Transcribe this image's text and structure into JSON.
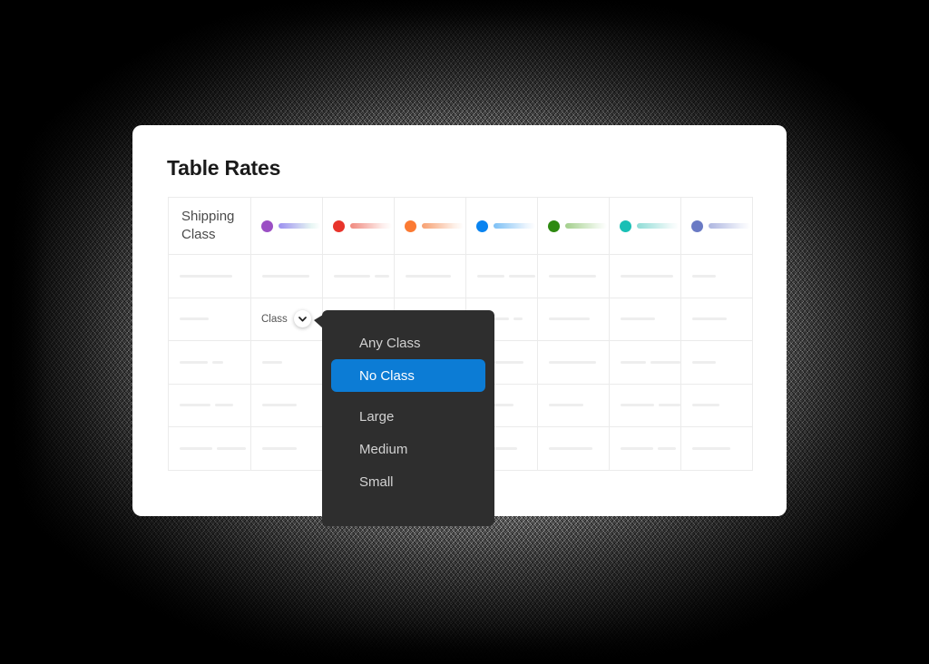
{
  "card": {
    "title": "Table Rates"
  },
  "table": {
    "first_column_header": "Shipping Class",
    "column_chips": [
      {
        "name": "chip-purple",
        "dot": "#9b4fc4",
        "bar_from": "#9b8ff0",
        "bar_to": "#e6f5f3"
      },
      {
        "name": "chip-red",
        "dot": "#e8342b",
        "bar_from": "#f0897e",
        "bar_to": "#fdeeec"
      },
      {
        "name": "chip-orange",
        "dot": "#fb7a33",
        "bar_from": "#f7a071",
        "bar_to": "#fdf0e8"
      },
      {
        "name": "chip-blue",
        "dot": "#0a84f0",
        "bar_from": "#7cc0f5",
        "bar_to": "#eaf4fd"
      },
      {
        "name": "chip-green",
        "dot": "#2e8a10",
        "bar_from": "#a3cf8c",
        "bar_to": "#eef7ea"
      },
      {
        "name": "chip-teal",
        "dot": "#19bfb5",
        "bar_from": "#8fdcd6",
        "bar_to": "#ecf8f7"
      },
      {
        "name": "chip-slate",
        "dot": "#6a7ac4",
        "bar_from": "#aeb6e0",
        "bar_to": "#f0f2fa"
      }
    ],
    "rows": [
      {
        "cells": [
          {
            "lines": [
              58
            ]
          },
          {
            "lines": [
              52
            ]
          },
          {
            "lines": [
              40,
              16
            ]
          },
          {
            "lines": [
              50
            ]
          },
          {
            "lines": [
              30,
              29
            ]
          },
          {
            "lines": [
              52
            ]
          },
          {
            "lines": [
              58
            ]
          },
          {
            "lines": [
              26
            ]
          }
        ]
      },
      {
        "cells": [
          {
            "lines": [
              32
            ]
          },
          {
            "type": "class-dropdown",
            "label": "Class"
          },
          {
            "lines": [
              0
            ]
          },
          {
            "lines": [
              0
            ]
          },
          {
            "lines": [
              35,
              10
            ]
          },
          {
            "lines": [
              45
            ]
          },
          {
            "lines": [
              38
            ]
          },
          {
            "lines": [
              38
            ]
          }
        ]
      },
      {
        "cells": [
          {
            "lines": [
              31,
              12
            ]
          },
          {
            "lines": [
              22
            ]
          },
          {
            "lines": [
              0
            ]
          },
          {
            "lines": [
              0
            ]
          },
          {
            "lines": [
              14,
              32
            ]
          },
          {
            "lines": [
              52
            ]
          },
          {
            "lines": [
              30,
              36
            ]
          },
          {
            "lines": [
              26
            ]
          }
        ]
      },
      {
        "cells": [
          {
            "lines": [
              34,
              20
            ]
          },
          {
            "lines": [
              38
            ]
          },
          {
            "lines": [
              0
            ]
          },
          {
            "lines": [
              0
            ]
          },
          {
            "lines": [
              10,
              25
            ]
          },
          {
            "lines": [
              38
            ]
          },
          {
            "lines": [
              38,
              25
            ]
          },
          {
            "lines": [
              30
            ]
          }
        ]
      },
      {
        "cells": [
          {
            "lines": [
              36,
              32
            ]
          },
          {
            "lines": [
              38
            ]
          },
          {
            "lines": [
              0
            ]
          },
          {
            "lines": [
              0
            ]
          },
          {
            "lines": [
              44
            ]
          },
          {
            "lines": [
              48
            ]
          },
          {
            "lines": [
              36,
              20
            ]
          },
          {
            "lines": [
              42
            ]
          }
        ]
      }
    ]
  },
  "dropdown_menu": {
    "items": [
      {
        "label": "Any Class",
        "selected": false
      },
      {
        "label": "No Class",
        "selected": true
      },
      {
        "label": "Large",
        "selected": false
      },
      {
        "label": "Medium",
        "selected": false
      },
      {
        "label": "Small",
        "selected": false
      }
    ],
    "background_color": "#2e2e2e",
    "selected_color": "#0c7cd5",
    "text_color": "#d2d2d2"
  },
  "icons": {
    "chevron_down": "chevron-down-icon"
  }
}
